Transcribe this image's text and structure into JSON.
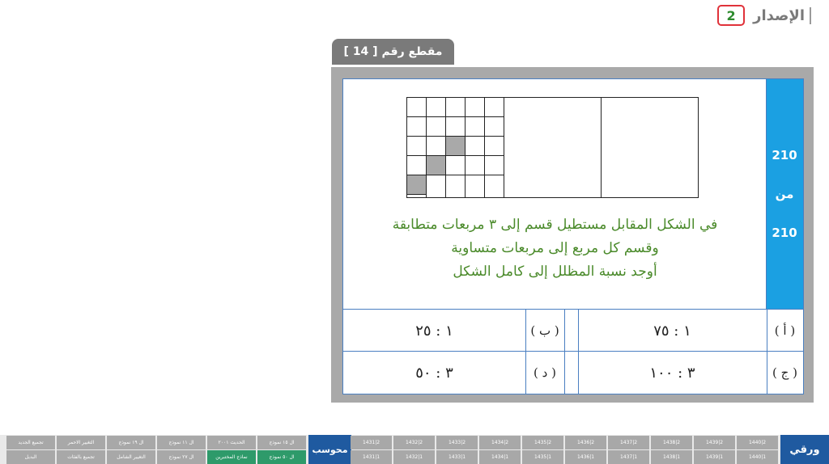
{
  "header": {
    "edition_label": "الإصدار",
    "edition_number": "2"
  },
  "section": {
    "title": "مقطع رقم [ 14 ]"
  },
  "counter": {
    "current": "210",
    "sep": "من",
    "total": "210"
  },
  "question": {
    "lines": [
      "في الشكل المقابل مستطيل قسم إلى ٣ مربعات متطابقة",
      "وقسم كل مربع إلى مربعات متساوية",
      "أوجد نسبة المظلل إلى كامل الشكل"
    ]
  },
  "answers": [
    {
      "letter": "( أ )",
      "value": "١ : ٧٥"
    },
    {
      "letter": "( ب )",
      "value": "١ : ٢٥"
    },
    {
      "letter": "( ج )",
      "value": "٣ : ١٠٠"
    },
    {
      "letter": "( د )",
      "value": "٣ : ٥٠"
    }
  ],
  "bottom": {
    "paper_label": "ورقي",
    "computer_label": "محوسب",
    "years_top": [
      "1440|2",
      "1439|2",
      "1438|2",
      "1437|2",
      "1436|2",
      "1435|2",
      "1434|2",
      "1433|2",
      "1432|2",
      "1431|2"
    ],
    "years_bottom": [
      "1440|1",
      "1439|1",
      "1438|1",
      "1437|1",
      "1436|1",
      "1435|1",
      "1434|1",
      "1433|1",
      "1432|1",
      "1431|1"
    ],
    "left_top": [
      "ال ١٥ نموذج",
      "الحديث ٢٠٠١",
      "ال ١١ نموذج",
      "ال ١٩ نموذج",
      "التغيير الاحمر",
      "تجميع الجديد"
    ],
    "left_bottom": [
      "ال ٥٠ نموذج",
      "نماذج المختبرين",
      "ال ٢٧ نموذج",
      "التغيير الشامل",
      "تجميع بالفئات",
      "البديل"
    ]
  },
  "colors": {
    "accent_blue": "#1ba0e2",
    "nav_blue": "#1f5aa0",
    "text_green": "#4a8a2a",
    "alert_red": "#e0323a"
  }
}
